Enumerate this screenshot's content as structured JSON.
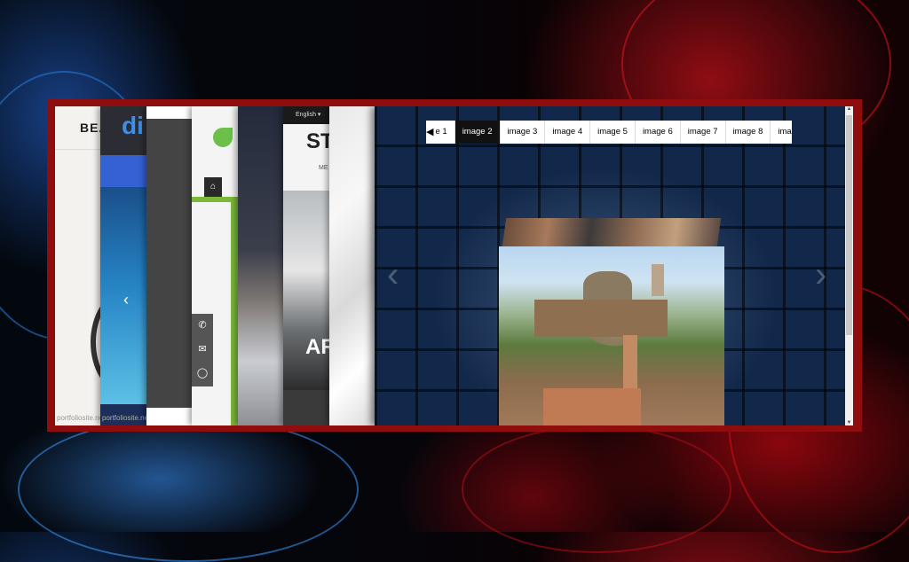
{
  "gallery": {
    "tabs": [
      "e 1",
      "image 2",
      "image 3",
      "image 4",
      "image 5",
      "image 6",
      "image 7",
      "image 8",
      "imag"
    ],
    "active_tab_index": 1
  },
  "cards": {
    "card1": {
      "title": "BEA",
      "url": "portfoliosite.net/t"
    },
    "card2": {
      "logo": "di",
      "url": "portfoliosite.net/t"
    },
    "card6": {
      "language": "English ▾",
      "heading": "ST",
      "menu": "ME",
      "overlay": "AR"
    }
  },
  "colors": {
    "frame": "#8f0d0d",
    "accent_blue": "#3d8ee6",
    "green": "#7bb93a"
  }
}
